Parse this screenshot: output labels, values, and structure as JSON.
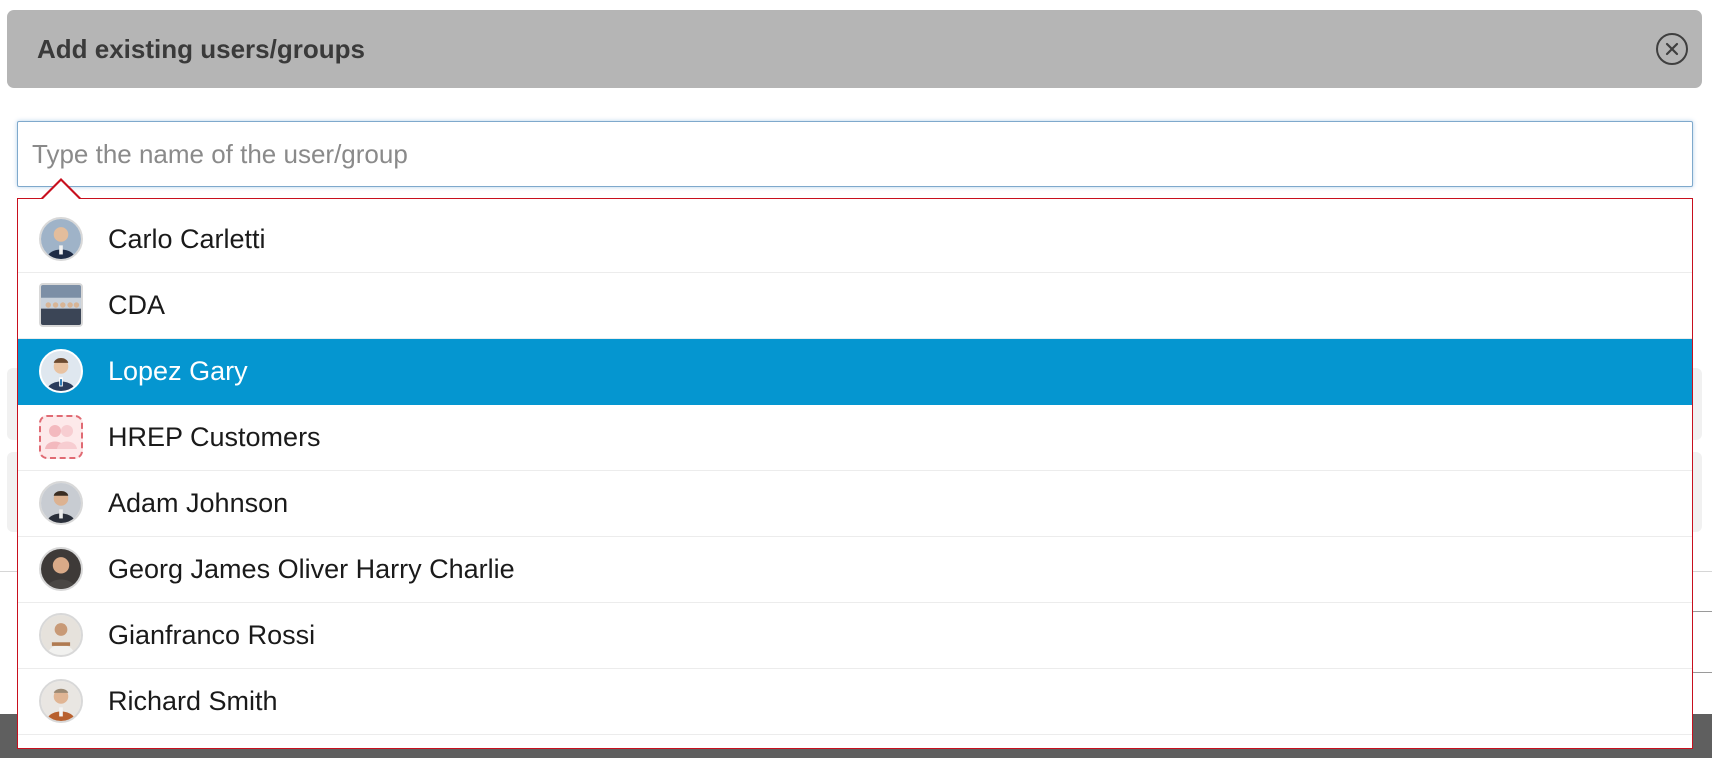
{
  "dialog": {
    "title": "Add existing users/groups",
    "close_icon": "close-circle-icon"
  },
  "search": {
    "placeholder": "Type the name of the user/group",
    "value": ""
  },
  "dropdown": {
    "selected_index": 2,
    "items": [
      {
        "label": "Carlo Carletti",
        "icon": "user-avatar",
        "type": "user"
      },
      {
        "label": "CDA",
        "icon": "group-photo",
        "type": "group"
      },
      {
        "label": "Lopez Gary",
        "icon": "user-avatar",
        "type": "user"
      },
      {
        "label": "HREP Customers",
        "icon": "group-placeholder-icon",
        "type": "group"
      },
      {
        "label": "Adam Johnson",
        "icon": "user-avatar",
        "type": "user"
      },
      {
        "label": "Georg James Oliver Harry Charlie",
        "icon": "user-avatar",
        "type": "user"
      },
      {
        "label": "Gianfranco Rossi",
        "icon": "user-avatar",
        "type": "user"
      },
      {
        "label": "Richard Smith",
        "icon": "user-avatar",
        "type": "user"
      }
    ]
  },
  "colors": {
    "header_bg": "#b5b5b5",
    "selected_bg": "#0596d0",
    "dropdown_border": "#c8101e",
    "input_focus_border": "#7fa9cc"
  }
}
